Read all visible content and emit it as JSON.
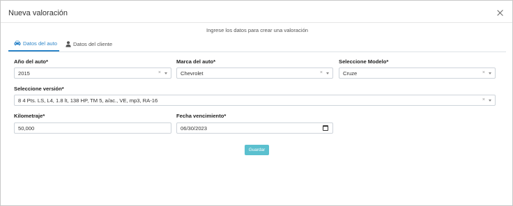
{
  "modal": {
    "title": "Nueva valoración",
    "subtitle": "Ingrese los datos para crear una valoración"
  },
  "tabs": [
    {
      "label": "Datos del auto",
      "icon": "car-icon",
      "active": true
    },
    {
      "label": "Datos del cliente",
      "icon": "user-icon",
      "active": false
    }
  ],
  "form": {
    "anio": {
      "label": "Año del auto*",
      "value": "2015"
    },
    "marca": {
      "label": "Marca del auto*",
      "value": "Chevrolet"
    },
    "modelo": {
      "label": "Seleccione Modelo*",
      "value": "Cruze"
    },
    "version": {
      "label": "Seleccione versión*",
      "value": "8 4 Pts. LS, L4, 1.8 lt, 138 HP, TM 5, a/ac., VE, mp3, RA-16"
    },
    "kilometraje": {
      "label": "Kilometraje*",
      "value": "50,000"
    },
    "fecha": {
      "label": "Fecha vencimiento*",
      "value": "06/30/2023"
    }
  },
  "clear_symbol": "×",
  "submit_label": "Guardar",
  "colors": {
    "accent": "#2f86c9",
    "button": "#5bc0cf"
  }
}
